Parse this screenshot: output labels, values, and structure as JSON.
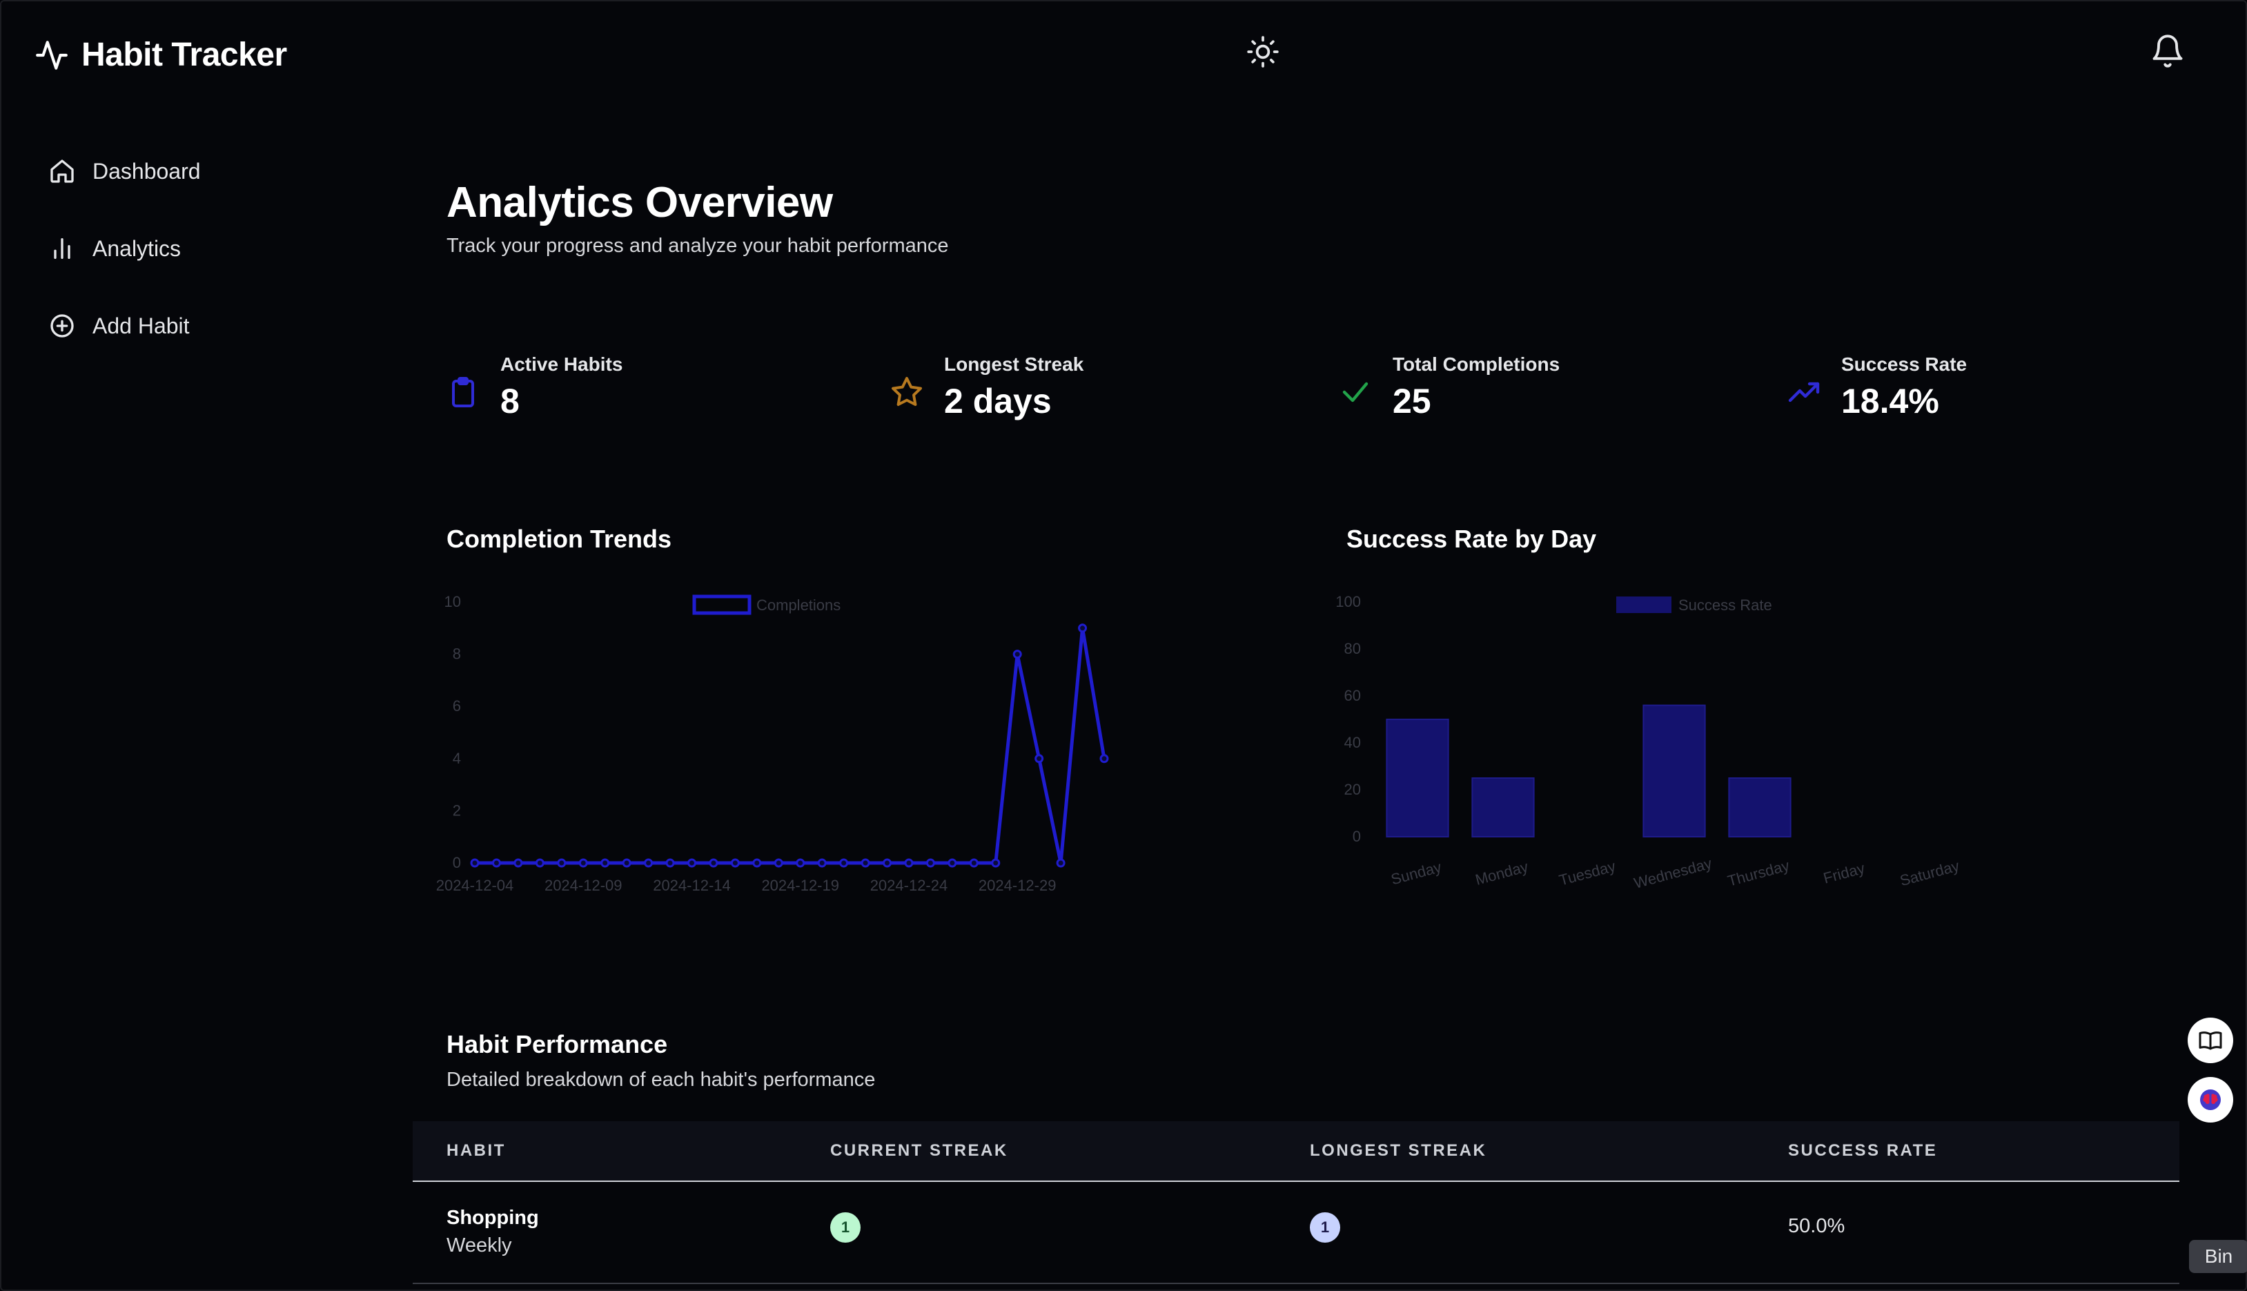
{
  "app": {
    "title": "Habit Tracker"
  },
  "sidebar": {
    "items": [
      {
        "label": "Dashboard",
        "icon": "home-icon"
      },
      {
        "label": "Analytics",
        "icon": "bar-chart-icon"
      },
      {
        "label": "Add Habit",
        "icon": "plus-circle-icon"
      }
    ]
  },
  "header": {
    "theme_icon": "sun-icon",
    "notifications_icon": "bell-icon"
  },
  "page": {
    "title": "Analytics Overview",
    "subtitle": "Track your progress and analyze your habit performance"
  },
  "stats": [
    {
      "label": "Active Habits",
      "value": "8",
      "icon": "clipboard-icon",
      "color": "#2f2bd6"
    },
    {
      "label": "Longest Streak",
      "value": "2 days",
      "icon": "star-icon",
      "color": "#b7791f"
    },
    {
      "label": "Total Completions",
      "value": "25",
      "icon": "check-icon",
      "color": "#22a34a"
    },
    {
      "label": "Success Rate",
      "value": "18.4%",
      "icon": "trending-up-icon",
      "color": "#2f2bd6"
    }
  ],
  "charts": {
    "trends_title": "Completion Trends",
    "success_title": "Success Rate by Day"
  },
  "chart_data": [
    {
      "type": "line",
      "title": "Completion Trends",
      "legend": [
        "Completions"
      ],
      "legend_position": "top",
      "xlabel": "",
      "ylabel": "",
      "ylim": [
        0,
        10
      ],
      "yticks": [
        0,
        2,
        4,
        6,
        8,
        10
      ],
      "xticks": [
        "2024-12-04",
        "2024-12-09",
        "2024-12-14",
        "2024-12-19",
        "2024-12-24",
        "2024-12-29"
      ],
      "series": [
        {
          "name": "Completions",
          "color": "#1f1ccf",
          "x": [
            "2024-12-04",
            "2024-12-05",
            "2024-12-06",
            "2024-12-07",
            "2024-12-08",
            "2024-12-09",
            "2024-12-10",
            "2024-12-11",
            "2024-12-12",
            "2024-12-13",
            "2024-12-14",
            "2024-12-15",
            "2024-12-16",
            "2024-12-17",
            "2024-12-18",
            "2024-12-19",
            "2024-12-20",
            "2024-12-21",
            "2024-12-22",
            "2024-12-23",
            "2024-12-24",
            "2024-12-25",
            "2024-12-26",
            "2024-12-27",
            "2024-12-28",
            "2024-12-29",
            "2024-12-30",
            "2024-12-31",
            "2025-01-01",
            "2025-01-02"
          ],
          "values": [
            0,
            0,
            0,
            0,
            0,
            0,
            0,
            0,
            0,
            0,
            0,
            0,
            0,
            0,
            0,
            0,
            0,
            0,
            0,
            0,
            0,
            0,
            0,
            0,
            0,
            8,
            4,
            0,
            9,
            4
          ]
        }
      ]
    },
    {
      "type": "bar",
      "title": "Success Rate by Day",
      "legend": [
        "Success Rate"
      ],
      "legend_position": "top",
      "ylim": [
        0,
        100
      ],
      "yticks": [
        0,
        20,
        40,
        60,
        80,
        100
      ],
      "categories": [
        "Sunday",
        "Monday",
        "Tuesday",
        "Wednesday",
        "Thursday",
        "Friday",
        "Saturday"
      ],
      "series": [
        {
          "name": "Success Rate",
          "color": "#14126e",
          "values": [
            50,
            25,
            0,
            56,
            25,
            0,
            0
          ]
        }
      ]
    }
  ],
  "performance": {
    "title": "Habit Performance",
    "subtitle": "Detailed breakdown of each habit's performance",
    "columns": [
      "HABIT",
      "CURRENT STREAK",
      "LONGEST STREAK",
      "SUCCESS RATE"
    ],
    "rows": [
      {
        "name": "Shopping",
        "frequency": "Weekly",
        "current_streak": "1",
        "longest_streak": "1",
        "success_rate": "50.0%"
      }
    ]
  },
  "floating": {
    "book_icon": "book-icon",
    "brain_icon": "brain-icon",
    "bin_label": "Bin"
  }
}
